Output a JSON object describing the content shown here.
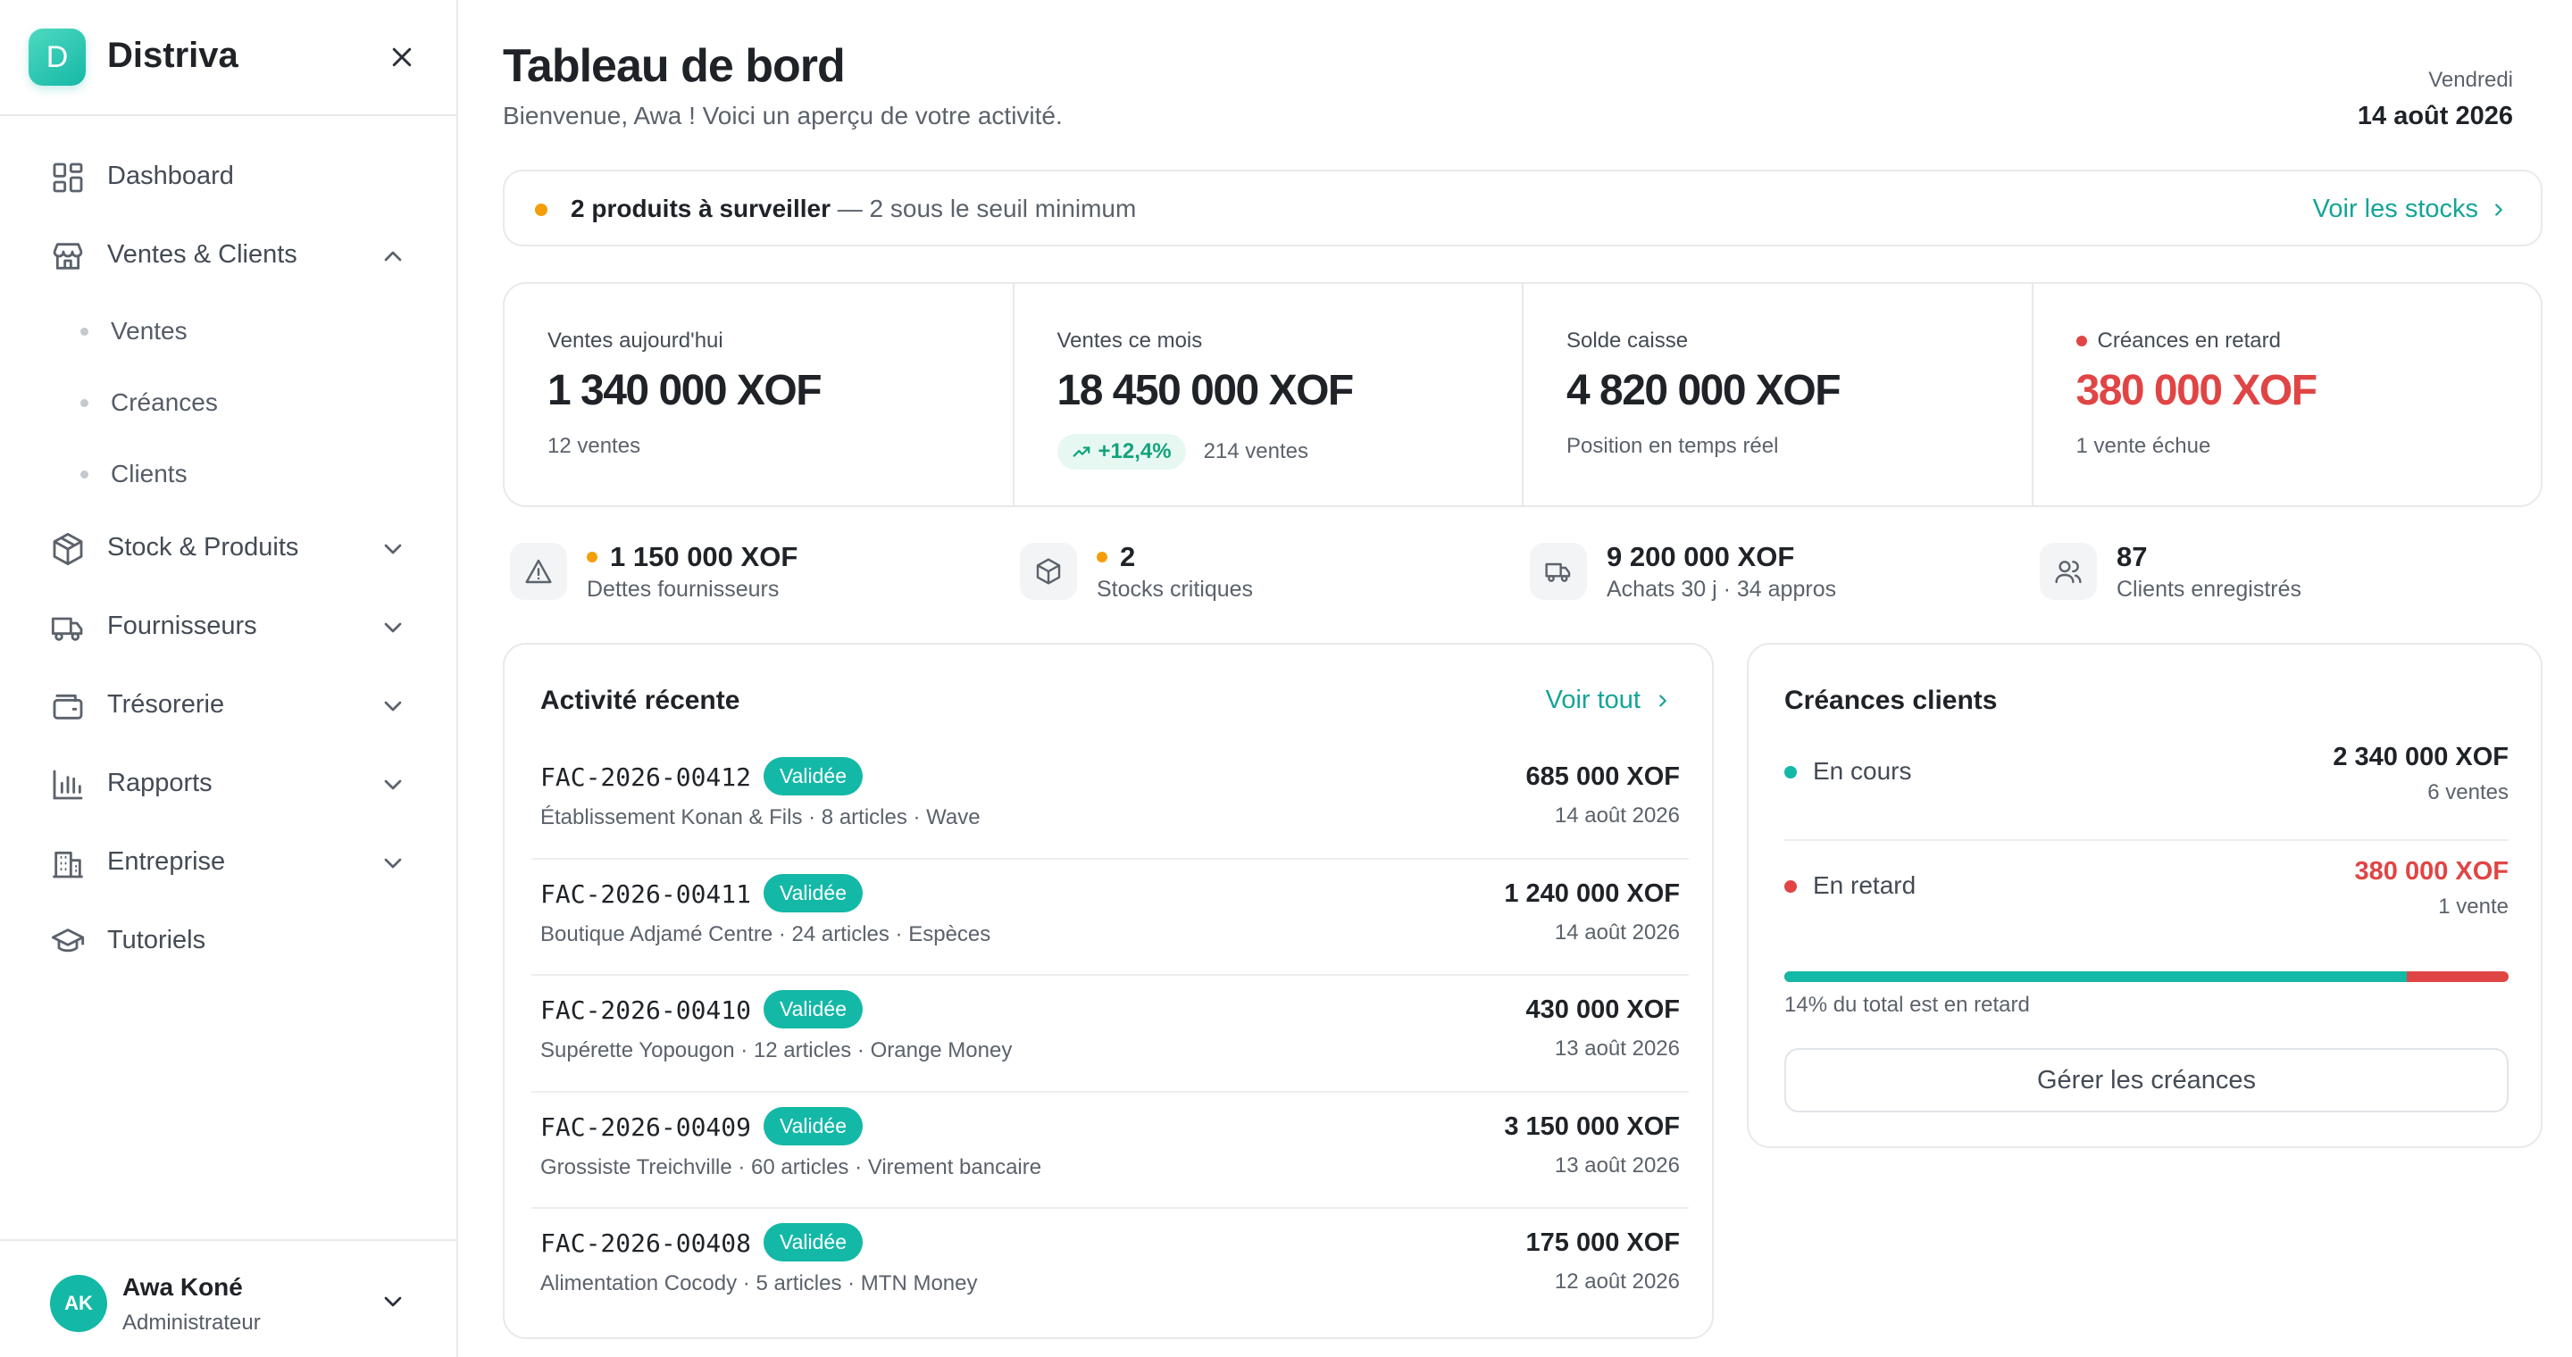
{
  "app": {
    "name": "Distriva",
    "logo_letter": "D",
    "accent": "#14b8a6"
  },
  "sidebar": {
    "items": [
      {
        "label": "Dashboard",
        "icon": "grid-icon"
      },
      {
        "label": "Ventes & Clients",
        "icon": "store-icon",
        "expanded": true,
        "children": [
          {
            "label": "Ventes"
          },
          {
            "label": "Créances"
          },
          {
            "label": "Clients"
          }
        ]
      },
      {
        "label": "Stock & Produits",
        "icon": "box-icon"
      },
      {
        "label": "Fournisseurs",
        "icon": "truck-icon"
      },
      {
        "label": "Trésorerie",
        "icon": "wallet-icon"
      },
      {
        "label": "Rapports",
        "icon": "bar-chart-icon"
      },
      {
        "label": "Entreprise",
        "icon": "building-icon"
      },
      {
        "label": "Tutoriels",
        "icon": "graduation-cap-icon"
      }
    ],
    "user": {
      "initials": "AK",
      "name": "Awa Koné",
      "role": "Administrateur"
    }
  },
  "header": {
    "title": "Tableau de bord",
    "subtitle": "Bienvenue, Awa ! Voici un aperçu de votre activité.",
    "weekday": "Vendredi",
    "date": "14 août 2026"
  },
  "alert": {
    "strong": "2 produits à surveiller",
    "rest": " — 2 sous le seuil minimum",
    "link": "Voir les stocks"
  },
  "kpis": [
    {
      "label": "Ventes aujourd'hui",
      "value": "1 340 000 XOF",
      "note": "12 ventes"
    },
    {
      "label": "Ventes ce mois",
      "value": "18 450 000 XOF",
      "trend": "+12,4%",
      "note": "214 ventes"
    },
    {
      "label": "Solde caisse",
      "value": "4 820 000 XOF",
      "note": "Position en temps réel"
    },
    {
      "label": "Créances en retard",
      "value": "380 000 XOF",
      "note": "1 vente échue"
    }
  ],
  "stats": [
    {
      "value": "1 150 000 XOF",
      "label": "Dettes fournisseurs",
      "icon": "warning-icon"
    },
    {
      "value": "2",
      "label": "Stocks critiques",
      "icon": "box-icon"
    },
    {
      "value": "9 200 000 XOF",
      "label": "Achats 30 j · 34 appros",
      "icon": "truck-icon"
    },
    {
      "value": "87",
      "label": "Clients enregistrés",
      "icon": "users-icon"
    }
  ],
  "activity": {
    "title": "Activité récente",
    "link": "Voir tout",
    "rows": [
      {
        "invoice": "FAC-2026-00412",
        "status": "Validée",
        "meta": "Établissement Konan & Fils · 8 articles · Wave",
        "amount": "685 000 XOF",
        "date": "14 août 2026"
      },
      {
        "invoice": "FAC-2026-00411",
        "status": "Validée",
        "meta": "Boutique Adjamé Centre · 24 articles · Espèces",
        "amount": "1 240 000 XOF",
        "date": "14 août 2026"
      },
      {
        "invoice": "FAC-2026-00410",
        "status": "Validée",
        "meta": "Supérette Yopougon · 12 articles · Orange Money",
        "amount": "430 000 XOF",
        "date": "13 août 2026"
      },
      {
        "invoice": "FAC-2026-00409",
        "status": "Validée",
        "meta": "Grossiste Treichville · 60 articles · Virement bancaire",
        "amount": "3 150 000 XOF",
        "date": "13 août 2026"
      },
      {
        "invoice": "FAC-2026-00408",
        "status": "Validée",
        "meta": "Alimentation Cocody · 5 articles · MTN Money",
        "amount": "175 000 XOF",
        "date": "12 août 2026"
      }
    ]
  },
  "receivables": {
    "title": "Créances clients",
    "current": {
      "label": "En cours",
      "amount": "2 340 000 XOF",
      "count": "6 ventes",
      "color": "#14b8a6"
    },
    "overdue": {
      "label": "En retard",
      "amount": "380 000 XOF",
      "count": "1 vente",
      "color": "#e04545"
    },
    "overdue_share": 0.14,
    "note": "14% du total est en retard",
    "button": "Gérer les créances"
  }
}
